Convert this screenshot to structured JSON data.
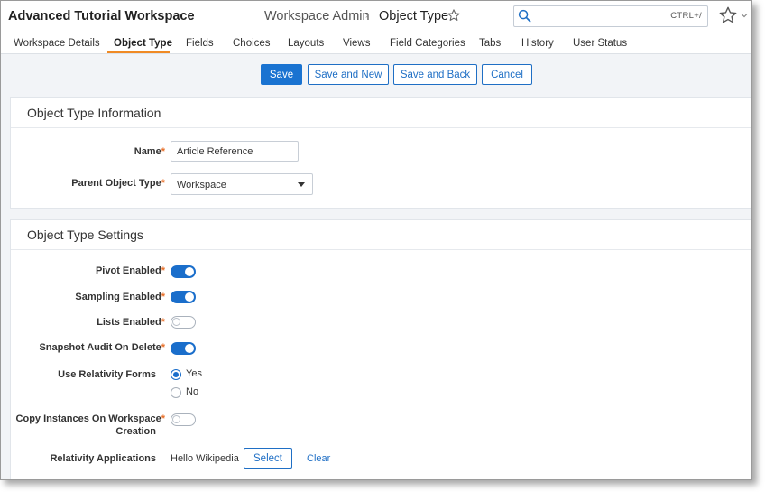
{
  "header": {
    "workspace_title": "Advanced Tutorial Workspace",
    "breadcrumb_parent": "Workspace Admin",
    "breadcrumb_current": "Object Type",
    "search": {
      "placeholder": "",
      "shortcut": "CTRL+/"
    }
  },
  "tabs": [
    {
      "label": "Workspace Details"
    },
    {
      "label": "Object Type",
      "active": true
    },
    {
      "label": "Fields"
    },
    {
      "label": "Choices"
    },
    {
      "label": "Layouts"
    },
    {
      "label": "Views"
    },
    {
      "label": "Field Categories"
    },
    {
      "label": "Tabs"
    },
    {
      "label": "History"
    },
    {
      "label": "User Status"
    }
  ],
  "actions": {
    "save": "Save",
    "save_and_new": "Save and New",
    "save_and_back": "Save and Back",
    "cancel": "Cancel"
  },
  "info_section": {
    "title": "Object Type Information",
    "name_label": "Name",
    "name_value": "Article Reference",
    "parent_label": "Parent Object Type",
    "parent_value": "Workspace"
  },
  "settings_section": {
    "title": "Object Type Settings",
    "pivot_label": "Pivot Enabled",
    "pivot_on": true,
    "sampling_label": "Sampling Enabled",
    "sampling_on": true,
    "lists_label": "Lists Enabled",
    "lists_on": false,
    "snapshot_label": "Snapshot Audit On Delete",
    "snapshot_on": true,
    "forms_label": "Use Relativity Forms",
    "forms_yes": "Yes",
    "forms_no": "No",
    "forms_selected": "Yes",
    "copy_label_line1": "Copy Instances On Workspace",
    "copy_label_line2": "Creation",
    "copy_on": false,
    "apps_label": "Relativity Applications",
    "apps_value": "Hello Wikipedia",
    "apps_select": "Select",
    "apps_clear": "Clear"
  },
  "colors": {
    "accent": "#1a73d1",
    "active_tab_underline": "#f08a24",
    "required_marker": "#e8702a"
  }
}
